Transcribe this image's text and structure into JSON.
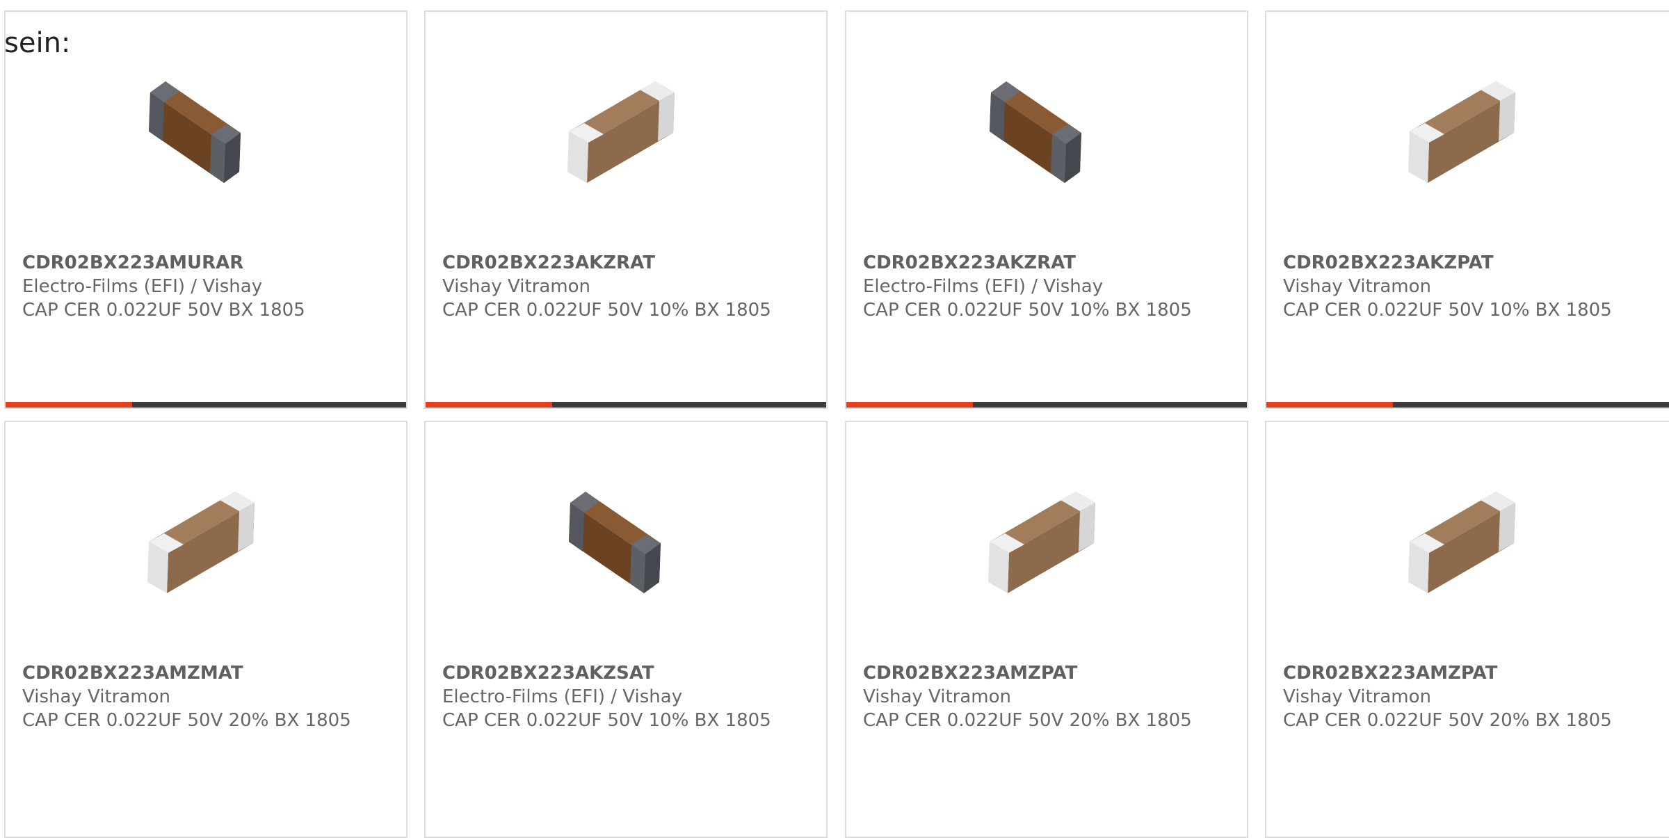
{
  "heading": "sein:",
  "colors": {
    "accent": "#e8401c",
    "bar_dark": "#3c3c3c",
    "card_border": "#dddddd",
    "text": "#666666"
  },
  "products": [
    {
      "part_number": "CDR02BX223AMURAR",
      "manufacturer": "Electro-Films (EFI) / Vishay",
      "description": "CAP CER 0.022UF 50V BX 1805",
      "image": "capacitor-dark-terminal-icon"
    },
    {
      "part_number": "CDR02BX223AKZRAT",
      "manufacturer": "Vishay Vitramon",
      "description": "CAP CER 0.022UF 50V 10% BX 1805",
      "image": "capacitor-light-terminal-icon"
    },
    {
      "part_number": "CDR02BX223AKZRAT",
      "manufacturer": "Electro-Films (EFI) / Vishay",
      "description": "CAP CER 0.022UF 50V 10% BX 1805",
      "image": "capacitor-dark-terminal-icon"
    },
    {
      "part_number": "CDR02BX223AKZPAT",
      "manufacturer": "Vishay Vitramon",
      "description": "CAP CER 0.022UF 50V 10% BX 1805",
      "image": "capacitor-light-terminal-icon"
    },
    {
      "part_number": "CDR02BX223AMZMAT",
      "manufacturer": "Vishay Vitramon",
      "description": "CAP CER 0.022UF 50V 20% BX 1805",
      "image": "capacitor-light-terminal-icon"
    },
    {
      "part_number": "CDR02BX223AKZSAT",
      "manufacturer": "Electro-Films (EFI) / Vishay",
      "description": "CAP CER 0.022UF 50V 10% BX 1805",
      "image": "capacitor-dark-terminal-icon"
    },
    {
      "part_number": "CDR02BX223AMZPAT",
      "manufacturer": "Vishay Vitramon",
      "description": "CAP CER 0.022UF 50V 20% BX 1805",
      "image": "capacitor-light-terminal-icon"
    },
    {
      "part_number": "CDR02BX223AMZPAT",
      "manufacturer": "Vishay Vitramon",
      "description": "CAP CER 0.022UF 50V 20% BX 1805",
      "image": "capacitor-light-terminal-icon"
    }
  ]
}
